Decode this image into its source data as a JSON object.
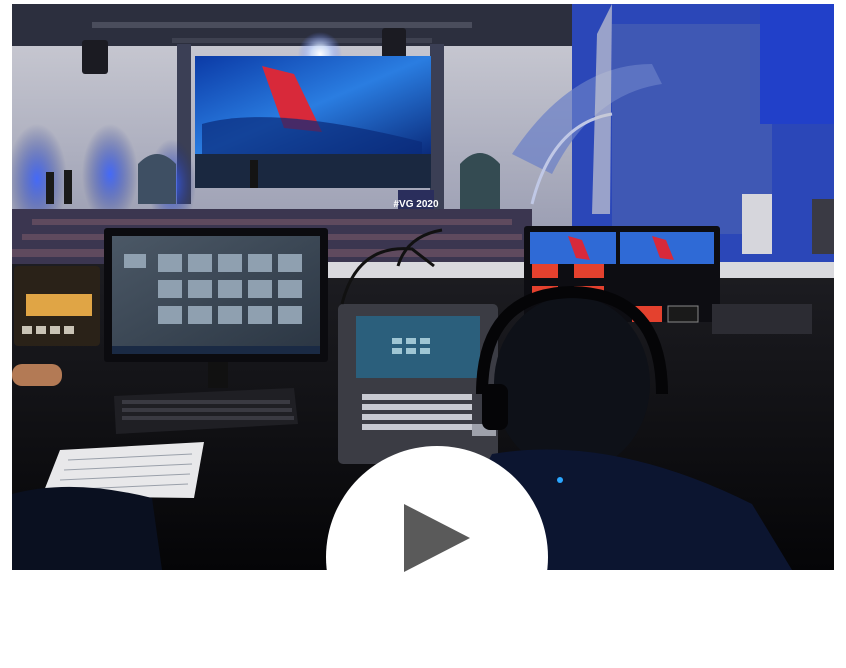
{
  "video": {
    "player": "video-thumbnail",
    "play_icon": "play-icon",
    "scene_sign_text": "#VG 2020",
    "colors": {
      "stage_blue": "#1b4fd8",
      "screen_glow": "#2a7de1",
      "play_button_bg": "#ffffff",
      "play_icon": "#5a5a5a"
    }
  }
}
